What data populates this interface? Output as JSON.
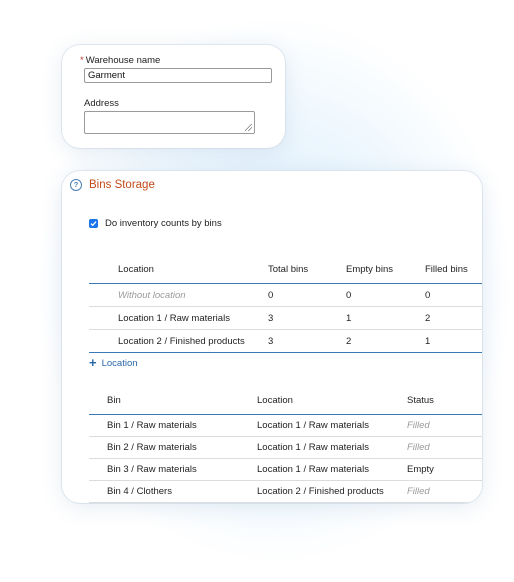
{
  "warehouse": {
    "name_label": "Warehouse name",
    "required_marker": "*",
    "name_value": "Garment",
    "address_label": "Address",
    "address_value": ""
  },
  "bins_storage": {
    "title": "Bins Storage",
    "help_icon": "?",
    "checkbox_label": "Do inventory counts by bins",
    "checkbox_checked": true,
    "locations_table": {
      "headers": [
        "Location",
        "Total bins",
        "Empty bins",
        "Filled bins"
      ],
      "rows": [
        [
          "Without location",
          "0",
          "0",
          "0"
        ],
        [
          "Location 1 / Raw materials",
          "3",
          "1",
          "2"
        ],
        [
          "Location 2 / Finished products",
          "3",
          "2",
          "1"
        ]
      ]
    },
    "add_location": {
      "icon": "+",
      "label": "Location"
    },
    "bins_table": {
      "headers": [
        "Bin",
        "Location",
        "Status"
      ],
      "rows": [
        [
          "Bin 1 / Raw materials",
          "Location 1 / Raw materials",
          "Filled"
        ],
        [
          "Bin 2 / Raw materials",
          "Location 1 / Raw materials",
          "Filled"
        ],
        [
          "Bin 3 / Raw materials",
          "Location 1 / Raw materials",
          "Empty"
        ],
        [
          "Bin 4 / Clothers",
          "Location 2 / Finished products",
          "Filled"
        ]
      ]
    }
  },
  "colors": {
    "accent_blue": "#1a73e8",
    "table_rule": "#3a78b8",
    "title_orange": "#c24a1a",
    "muted_text": "#9a9a9a"
  }
}
